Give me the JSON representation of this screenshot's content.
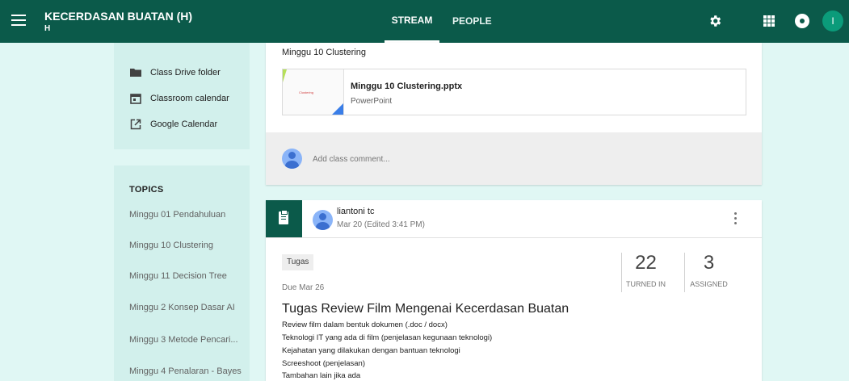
{
  "header": {
    "class_name": "KECERDASAN BUATAN (H)",
    "section": "H",
    "tabs": [
      {
        "label": "STREAM",
        "active": true
      },
      {
        "label": "PEOPLE",
        "active": false
      }
    ],
    "user_initial": "I",
    "icons": [
      "menu-icon",
      "gear-icon",
      "apps-icon",
      "notifications-icon"
    ],
    "brand_color": "#0b5a4a"
  },
  "sidebar": {
    "links": [
      {
        "label": "Class Drive folder",
        "icon": "folder-icon"
      },
      {
        "label": "Classroom calendar",
        "icon": "calendar-icon"
      },
      {
        "label": "Google Calendar",
        "icon": "external-link-icon"
      }
    ],
    "topics_header": "TOPICS",
    "topics": [
      "Minggu 01 Pendahuluan",
      "Minggu 10 Clustering",
      "Minggu 11 Decision Tree",
      "Minggu 2 Konsep Dasar AI",
      "Minggu 3 Metode Pencari...",
      "Minggu 4 Penalaran - Bayes"
    ]
  },
  "post": {
    "title": "Minggu 10 Clustering",
    "attachment": {
      "name": "Minggu 10 Clustering.pptx",
      "type": "PowerPoint",
      "thumb_text": "Clustering"
    },
    "comment_placeholder": "Add class comment..."
  },
  "assignment": {
    "author": "liantoni tc",
    "date": "Mar 20 (Edited 3:41 PM)",
    "topic": "Tugas",
    "due": "Due Mar 26",
    "turned_in": "22",
    "turned_in_label": "TURNED IN",
    "assigned": "3",
    "assigned_label": "ASSIGNED",
    "title": "Tugas Review Film Mengenai Kecerdasan Buatan",
    "description": [
      "Review film dalam bentuk dokumen (.doc / docx)",
      "Teknologi IT yang ada di film (penjelasan kegunaan teknologi)",
      "Kejahatan yang dilakukan dengan bantuan teknologi",
      "Screeshoot (penjelasan)",
      "Tambahan lain jika ada"
    ]
  }
}
